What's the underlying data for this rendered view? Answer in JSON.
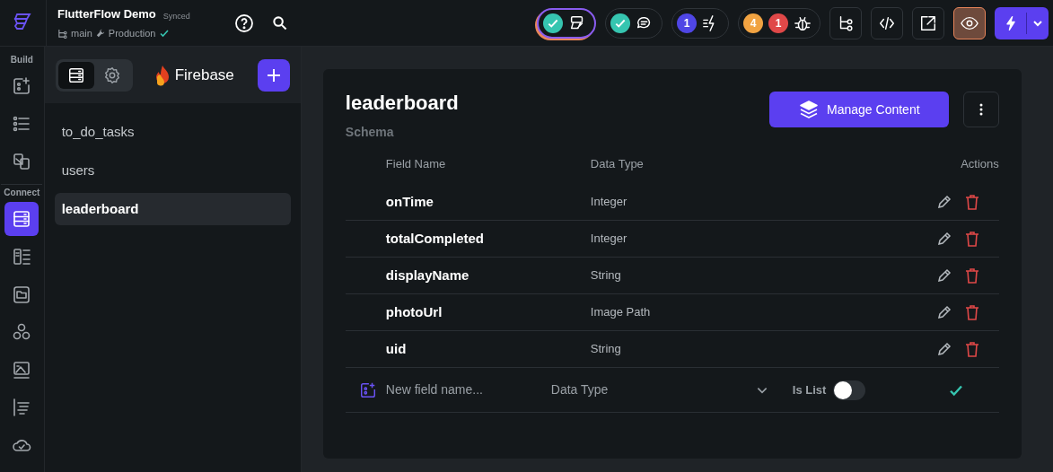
{
  "project": {
    "name": "FlutterFlow Demo",
    "sync_status": "Synced",
    "branch": "main",
    "environment": "Production",
    "deployed": true
  },
  "toolbar": [
    {
      "kind": "status",
      "checked": true,
      "selected": true
    },
    {
      "kind": "status",
      "checked": true,
      "selected": false
    },
    {
      "kind": "status",
      "counts": [
        {
          "text": "1",
          "color": "#4f46e5"
        }
      ],
      "checked": false,
      "selected": false
    },
    {
      "kind": "status",
      "counts": [
        {
          "text": "4",
          "color": "#f1a342"
        },
        {
          "text": "1",
          "color": "#e04848"
        }
      ],
      "checked": false,
      "selected": false
    },
    {
      "kind": "square",
      "selected": false
    },
    {
      "kind": "square",
      "selected": false
    },
    {
      "kind": "square",
      "selected": false
    },
    {
      "kind": "square",
      "selected": true
    },
    {
      "kind": "run"
    }
  ],
  "rail": [
    {
      "heading": "Build",
      "items": [
        {
          "selected": false
        },
        {
          "selected": false
        },
        {
          "selected": false
        }
      ]
    },
    {
      "heading": "Connect",
      "items": [
        {
          "selected": true
        },
        {
          "selected": false
        },
        {
          "selected": false
        },
        {
          "selected": false
        },
        {
          "selected": false
        },
        {
          "selected": false
        },
        {
          "selected": false
        }
      ]
    }
  ],
  "collections_panel": {
    "tabs": [
      {
        "selected": true
      },
      {
        "selected": false
      }
    ],
    "provider": "Firebase",
    "collections": [
      {
        "name": "to_do_tasks",
        "selected": false
      },
      {
        "name": "users",
        "selected": false
      },
      {
        "name": "leaderboard",
        "selected": true
      }
    ]
  },
  "schema": {
    "title": "leaderboard",
    "subtitle": "Schema",
    "manage_button": "Manage Content",
    "columns": [
      "Field Name",
      "Data Type",
      "Actions"
    ],
    "fields": [
      {
        "name": "onTime",
        "type": "Integer"
      },
      {
        "name": "totalCompleted",
        "type": "Integer"
      },
      {
        "name": "displayName",
        "type": "String"
      },
      {
        "name": "photoUrl",
        "type": "Image Path"
      },
      {
        "name": "uid",
        "type": "String"
      }
    ],
    "new_field": {
      "placeholder": "New field name...",
      "type_placeholder": "Data Type",
      "is_list_label": "Is List",
      "is_list": false
    }
  }
}
